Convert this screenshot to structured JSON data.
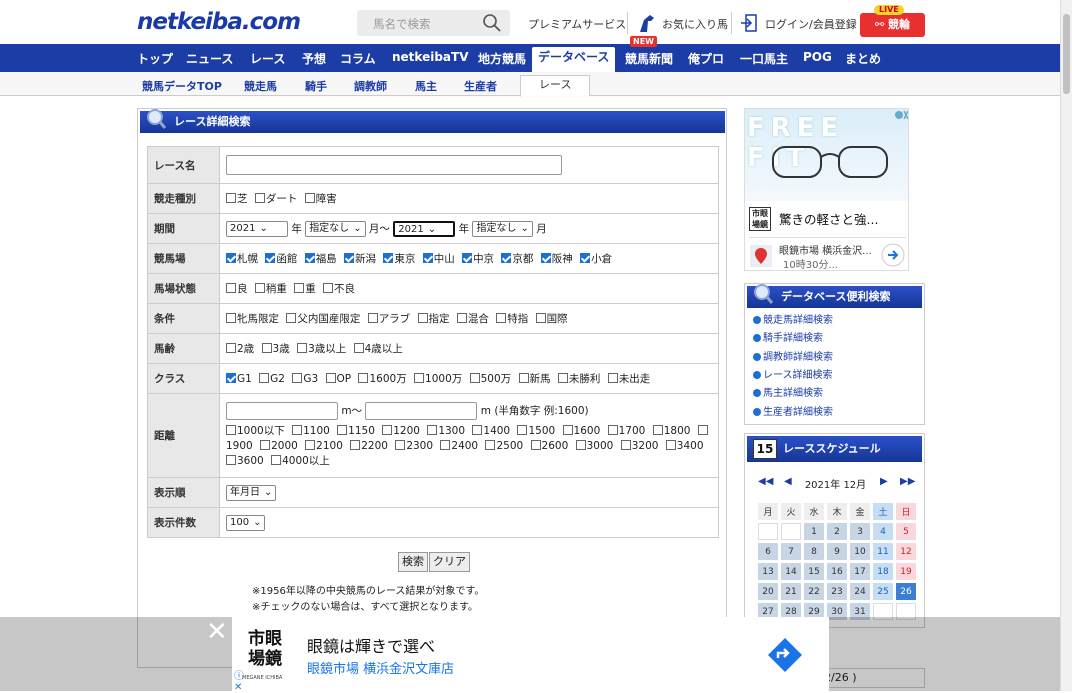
{
  "header": {
    "logo": "netkeiba.com",
    "search_placeholder": "馬名で検索",
    "premium": "プレミアムサービス",
    "favorites": "お気に入り馬",
    "login": "ログイン/会員登録",
    "live_tag": "LIVE",
    "live_label": "競輪"
  },
  "nav": {
    "items": [
      "トップ",
      "ニュース",
      "レース",
      "予想",
      "コラム",
      "netkeibaTV",
      "地方競馬",
      "データベース",
      "競馬新聞",
      "俺プロ",
      "一口馬主",
      "POG",
      "まとめ"
    ],
    "new_tag": "NEW"
  },
  "subnav": {
    "items": [
      "競馬データTOP",
      "競走馬",
      "騎手",
      "調教師",
      "馬主",
      "生産者",
      "レース"
    ]
  },
  "form": {
    "title": "レース詳細検索",
    "labels": {
      "name": "レース名",
      "type": "競走種別",
      "period": "期間",
      "track": "競馬場",
      "condition": "馬場状態",
      "terms": "条件",
      "age": "馬齢",
      "class": "クラス",
      "distance": "距離",
      "order": "表示順",
      "count": "表示件数"
    },
    "type_opts": [
      "芝",
      "ダート",
      "障害"
    ],
    "period": {
      "from_year": "2021",
      "from_month": "指定なし",
      "to_year": "2021",
      "to_month": "指定なし",
      "year": "年",
      "month": "月",
      "tilde": "月〜"
    },
    "tracks": [
      "札幌",
      "函館",
      "福島",
      "新潟",
      "東京",
      "中山",
      "中京",
      "京都",
      "阪神",
      "小倉"
    ],
    "conditions": [
      "良",
      "稍重",
      "重",
      "不良"
    ],
    "terms_opts": [
      "牝馬限定",
      "父内国産限定",
      "アラブ",
      "指定",
      "混合",
      "特指",
      "国際"
    ],
    "ages": [
      "2歳",
      "3歳",
      "3歳以上",
      "4歳以上"
    ],
    "classes": [
      "G1",
      "G2",
      "G3",
      "OP",
      "1600万",
      "1000万",
      "500万",
      "新馬",
      "未勝利",
      "未出走"
    ],
    "distance": {
      "unit_mid": "m〜",
      "unit_end": "m (半角数字 例:1600)",
      "opts": [
        "1000以下",
        "1100",
        "1150",
        "1200",
        "1300",
        "1400",
        "1500",
        "1600",
        "1700",
        "1800",
        "1900",
        "2000",
        "2100",
        "2200",
        "2300",
        "2400",
        "2500",
        "2600",
        "3000",
        "3200",
        "3400",
        "3600",
        "4000以上"
      ]
    },
    "order": "年月日",
    "count": "100",
    "search_btn": "検索",
    "clear_btn": "クリア",
    "notes": [
      "※1956年以降の中央競馬のレース結果が対象です。",
      "※チェックのない場合は、すべて選択となります。"
    ]
  },
  "ad1": {
    "banner": "FREE FIT",
    "headline": "驚きの軽さと強...",
    "shop": "眼鏡市場 横浜金沢...",
    "hours": "10時30分...",
    "logo": "市眼場鏡"
  },
  "db_links": {
    "title": "データベース便利検索",
    "items": [
      "競走馬詳細検索",
      "騎手詳細検索",
      "調教師詳細検索",
      "レース詳細検索",
      "馬主詳細検索",
      "生産者詳細検索"
    ]
  },
  "schedule": {
    "title": "レーススケジュール",
    "icon_day": "15",
    "month": "2021年 12月",
    "weekdays": [
      "月",
      "火",
      "水",
      "木",
      "金",
      "土",
      "日"
    ],
    "rows": [
      [
        "",
        "",
        "1",
        "2",
        "3",
        "4",
        "5"
      ],
      [
        "6",
        "7",
        "8",
        "9",
        "10",
        "11",
        "12"
      ],
      [
        "13",
        "14",
        "15",
        "16",
        "17",
        "18",
        "19"
      ],
      [
        "20",
        "21",
        "22",
        "23",
        "24",
        "25",
        "26"
      ],
      [
        "27",
        "28",
        "29",
        "30",
        "31",
        "",
        ""
      ]
    ]
  },
  "pagination": "2/26 )",
  "ad2": {
    "logo": "市眼場鏡",
    "tagline": "眼鏡は輝きで選べ",
    "shop": "眼鏡市場 横浜金沢文庫店",
    "logo_sub": "MEGANE ICHIBA"
  }
}
